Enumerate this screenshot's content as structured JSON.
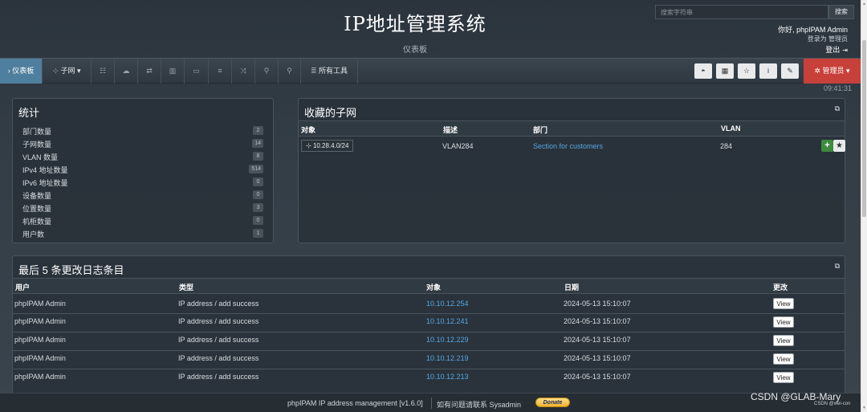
{
  "header": {
    "title": "IP地址管理系统",
    "subtitle": "仪表板",
    "search_placeholder": "搜索字符串",
    "search_button": "搜索",
    "greeting": "你好, phpIPAM Admin",
    "login_as": "登录为 管理员",
    "logout": "登出"
  },
  "nav": {
    "dashboard": "仪表板",
    "subnets": "子网",
    "all_tools": "所有工具",
    "admin": "管理员",
    "icons": [
      "sitemap-icon",
      "users-icon",
      "cloud-icon",
      "exchange-icon",
      "map-icon",
      "desktop-icon",
      "list-icon",
      "random-icon",
      "search-plus-icon",
      "search-icon"
    ],
    "tool_buttons": [
      "dashboard-icon",
      "grid-icon",
      "star-icon",
      "info-icon",
      "wrench-icon"
    ]
  },
  "clock": "09:41:31",
  "stats": {
    "title": "统计",
    "rows": [
      {
        "label": "部门数量",
        "value": "2"
      },
      {
        "label": "子网数量",
        "value": "14"
      },
      {
        "label": "VLAN 数量",
        "value": "8"
      },
      {
        "label": "IPv4 地址数量",
        "value": "514"
      },
      {
        "label": "IPv6 地址数量",
        "value": "0"
      },
      {
        "label": "设备数量",
        "value": "0"
      },
      {
        "label": "位置数量",
        "value": "3"
      },
      {
        "label": "机柜数量",
        "value": "0"
      },
      {
        "label": "用户数",
        "value": "1"
      }
    ]
  },
  "favorites": {
    "title": "收藏的子网",
    "columns": [
      "对象",
      "描述",
      "部门",
      "VLAN"
    ],
    "row": {
      "subnet": "10.28.4.0/24",
      "description": "VLAN284",
      "section": "Section for customers",
      "vlan": "284"
    }
  },
  "changelog": {
    "title_prefix": "最后",
    "title_count": "5",
    "title_suffix": "条更改日志条目",
    "columns": [
      "用户",
      "类型",
      "对象",
      "日期",
      "更改"
    ],
    "view_label": "View",
    "rows": [
      {
        "user": "phpIPAM Admin",
        "type": "IP address / add success",
        "object": "10.10.12.254",
        "date": "2024-05-13 15:10:07"
      },
      {
        "user": "phpIPAM Admin",
        "type": "IP address / add success",
        "object": "10.10.12.241",
        "date": "2024-05-13 15:10:07"
      },
      {
        "user": "phpIPAM Admin",
        "type": "IP address / add success",
        "object": "10.10.12.229",
        "date": "2024-05-13 15:10:07"
      },
      {
        "user": "phpIPAM Admin",
        "type": "IP address / add success",
        "object": "10.10.12.219",
        "date": "2024-05-13 15:10:07"
      },
      {
        "user": "phpIPAM Admin",
        "type": "IP address / add success",
        "object": "10.10.12.213",
        "date": "2024-05-13 15:10:07"
      }
    ]
  },
  "footer": {
    "app_info": "phpIPAM IP address management [v1.6.0]",
    "contact": "如有问题请联系 Sysadmin",
    "donate": "Donate"
  },
  "watermark": {
    "main": "CSDN @GLAB-Mary",
    "small": "CSDN @wei-con"
  }
}
